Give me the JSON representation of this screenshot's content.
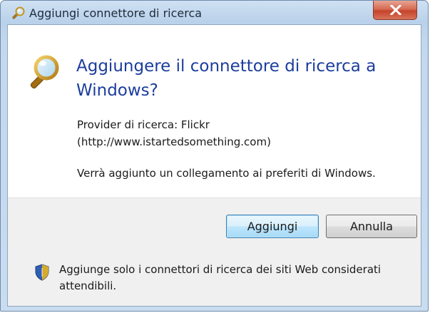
{
  "window": {
    "title": "Aggiungi connettore di ricerca",
    "close_icon": "close-icon"
  },
  "dialog": {
    "icon": "search-magnifier-icon",
    "heading": "Aggiungere il connettore di ricerca a Windows?",
    "provider_line1": "Provider di ricerca: Flickr",
    "provider_line2": "(http://www.istartedsomething.com)",
    "note": "Verrà aggiunto un collegamento ai preferiti di Windows."
  },
  "buttons": {
    "add_label": "Aggiungi",
    "cancel_label": "Annulla"
  },
  "footer": {
    "icon": "shield-icon",
    "text": "Aggiunge solo i connettori di ricerca dei siti Web considerati attendibili."
  },
  "colors": {
    "heading": "#1c3d9e",
    "close_button": "#c6432b",
    "primary_button_border": "#3c7fb1"
  }
}
